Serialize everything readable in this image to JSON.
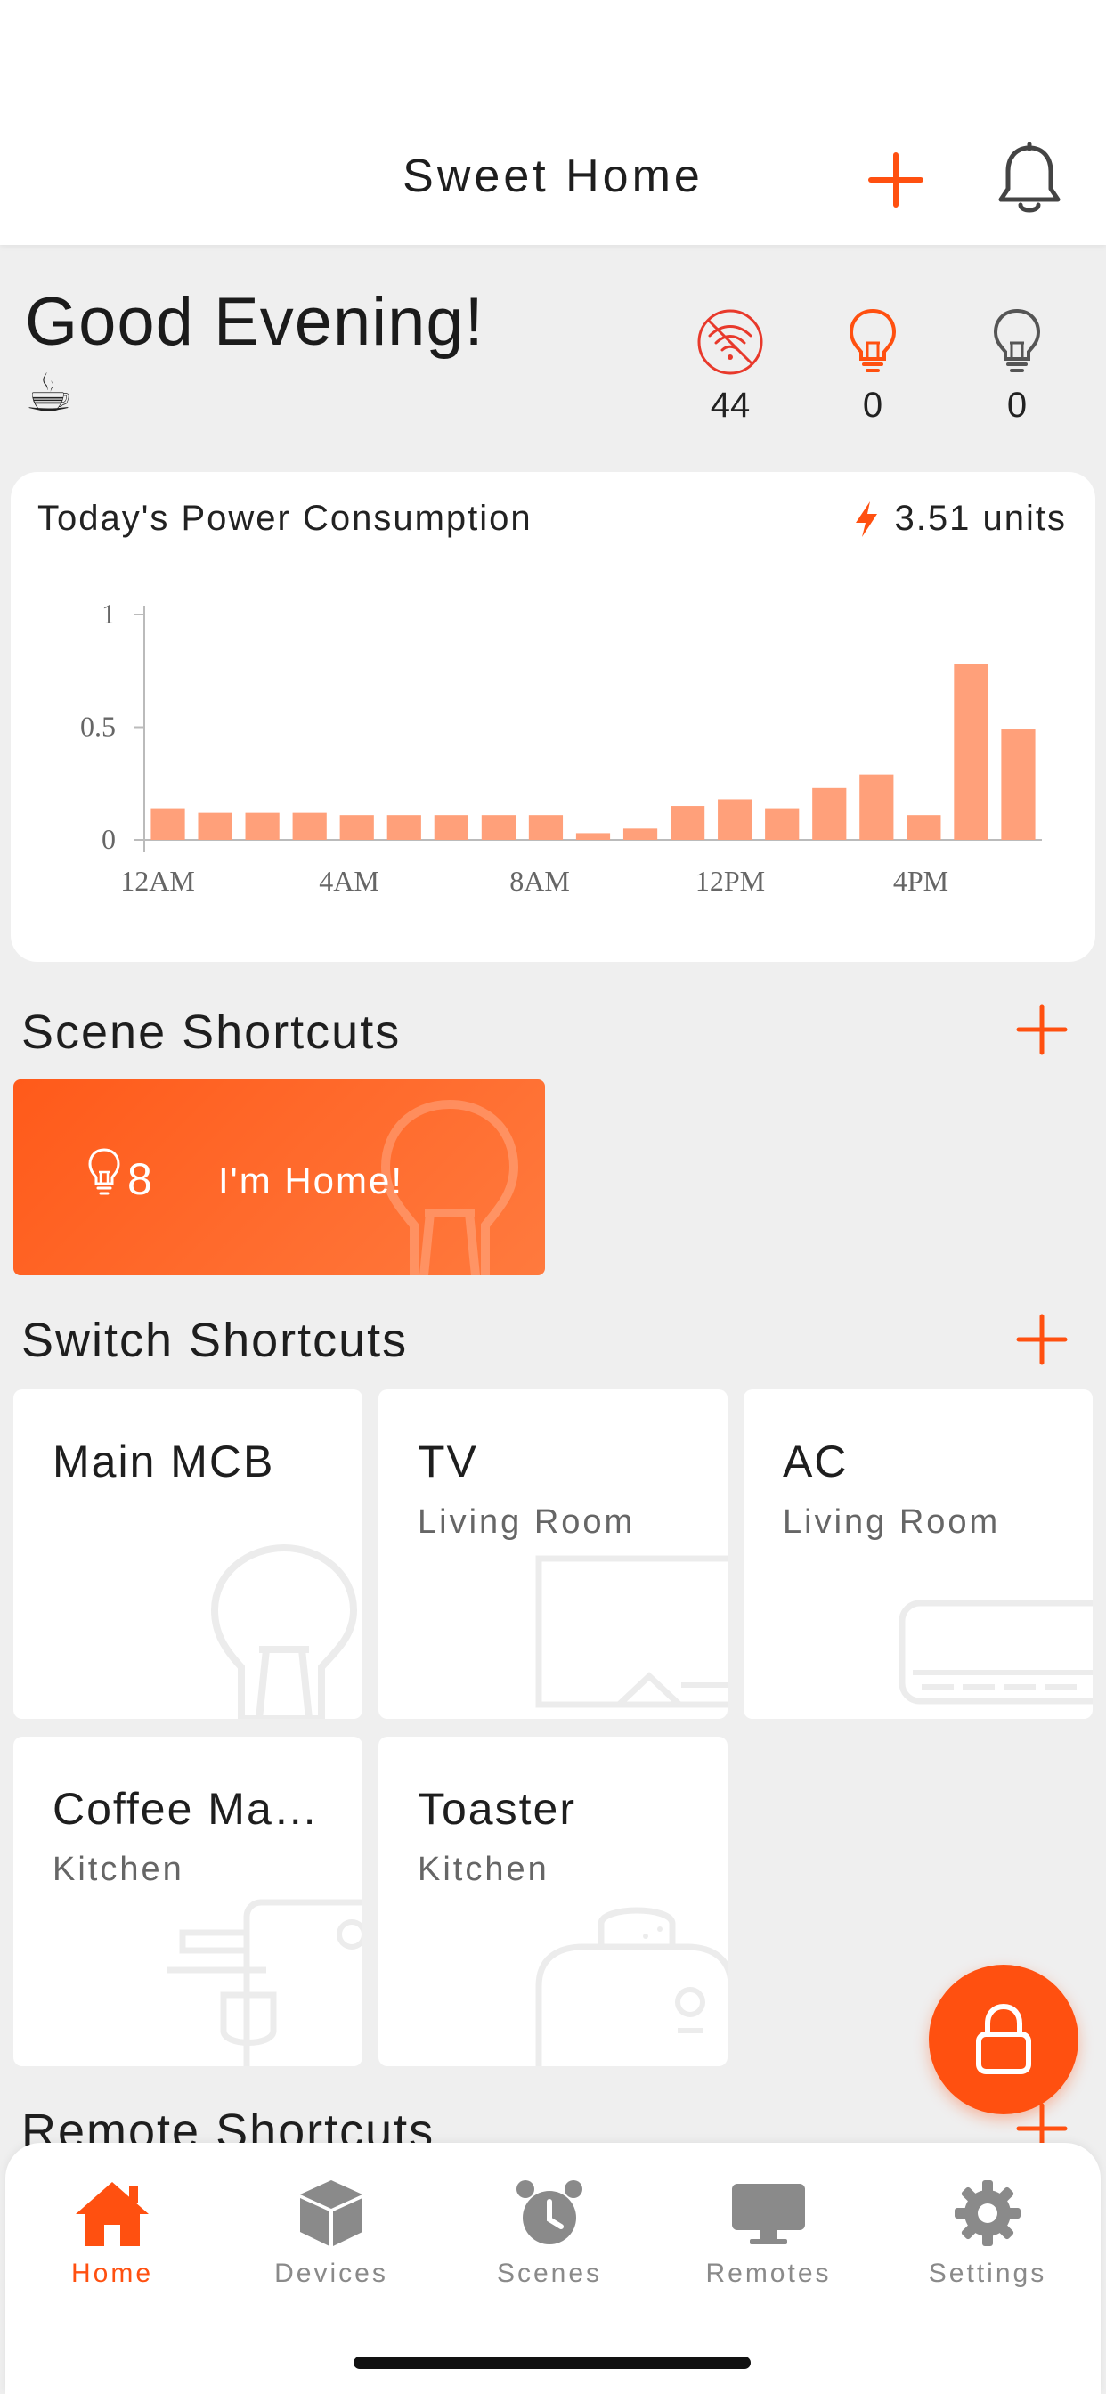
{
  "header": {
    "title": "Sweet Home",
    "add_icon": "plus-icon",
    "notification_icon": "bell-icon"
  },
  "greeting": {
    "text": "Good Evening!",
    "emoji": "☕"
  },
  "status": [
    {
      "icon": "wifi-off-icon",
      "count": "44"
    },
    {
      "icon": "bulb-on-icon",
      "count": "0"
    },
    {
      "icon": "bulb-off-icon",
      "count": "0"
    }
  ],
  "power": {
    "title": "Today's Power Consumption",
    "units": "3.51 units",
    "icon": "lightning-icon"
  },
  "chart_data": {
    "type": "bar",
    "ylim": [
      0,
      1
    ],
    "yticks": [
      "1",
      "0.5",
      "0"
    ],
    "xticks": [
      "12AM",
      "4AM",
      "8AM",
      "12PM",
      "4PM"
    ],
    "values": [
      0.14,
      0.12,
      0.12,
      0.12,
      0.11,
      0.11,
      0.11,
      0.11,
      0.11,
      0.03,
      0.05,
      0.15,
      0.18,
      0.14,
      0.23,
      0.29,
      0.11,
      0.78,
      0.49
    ],
    "color": "#ffa07a"
  },
  "scene_section": {
    "title": "Scene Shortcuts",
    "scenes": [
      {
        "count": "8",
        "name": "I'm Home!",
        "icon": "bulb-icon"
      }
    ]
  },
  "switch_section": {
    "title": "Switch Shortcuts",
    "switches": [
      {
        "name": "Main MCB",
        "room": "",
        "icon": "bulb-illustration"
      },
      {
        "name": "TV",
        "room": "Living Room",
        "icon": "tv-illustration"
      },
      {
        "name": "AC",
        "room": "Living Room",
        "icon": "ac-illustration"
      },
      {
        "name": "Coffee Ma…",
        "room": "Kitchen",
        "icon": "coffee-machine-illustration"
      },
      {
        "name": "Toaster",
        "room": "Kitchen",
        "icon": "toaster-illustration"
      }
    ]
  },
  "remote_section": {
    "title": "Remote Shortcuts"
  },
  "fab": {
    "icon": "lock-icon"
  },
  "nav": [
    {
      "label": "Home",
      "icon": "home-icon",
      "active": true
    },
    {
      "label": "Devices",
      "icon": "cube-icon",
      "active": false
    },
    {
      "label": "Scenes",
      "icon": "alarm-clock-icon",
      "active": false
    },
    {
      "label": "Remotes",
      "icon": "monitor-icon",
      "active": false
    },
    {
      "label": "Settings",
      "icon": "gear-icon",
      "active": false
    }
  ],
  "colors": {
    "accent": "#ff5010",
    "bar": "#ffa07a",
    "card": "#ffffff",
    "background": "#efefef"
  }
}
